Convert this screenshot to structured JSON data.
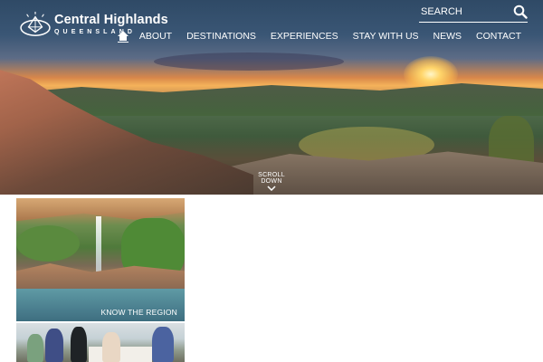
{
  "header": {
    "logo": {
      "name": "Central Highlands",
      "sub": "QUEENSLAND",
      "icon": "gemstone-logo-icon"
    },
    "search": {
      "placeholder": "SEARCH",
      "icon": "search-icon"
    },
    "nav": {
      "home_icon": "home-icon",
      "items": [
        {
          "label": "ABOUT"
        },
        {
          "label": "DESTINATIONS"
        },
        {
          "label": "EXPERIENCES"
        },
        {
          "label": "STAY WITH US"
        },
        {
          "label": "NEWS"
        },
        {
          "label": "CONTACT"
        }
      ]
    }
  },
  "hero": {
    "scroll_label": "SCROLL DOWN",
    "scroll_icon": "chevron-down-icon"
  },
  "tiles": [
    {
      "label": "KNOW THE REGION"
    },
    {
      "label": ""
    }
  ],
  "colors": {
    "text_on_image": "#ffffff",
    "page_background": "#ffffff"
  }
}
